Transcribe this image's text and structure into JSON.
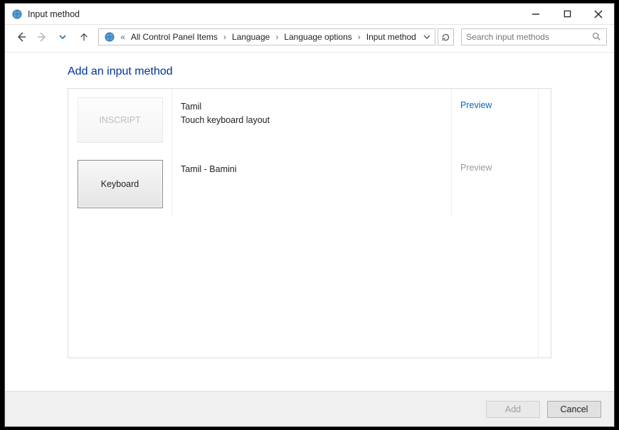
{
  "window": {
    "title": "Input method"
  },
  "breadcrumbs": {
    "items": [
      "All Control Panel Items",
      "Language",
      "Language options",
      "Input method"
    ],
    "prefix_glyph": "«"
  },
  "search": {
    "placeholder": "Search input methods"
  },
  "page": {
    "heading": "Add an input method"
  },
  "methods": [
    {
      "tile_label": "INSCRIPT",
      "name": "Tamil",
      "sub": "Touch keyboard layout",
      "preview_label": "Preview",
      "preview_enabled": true,
      "selected": false
    },
    {
      "tile_label": "Keyboard",
      "name": "Tamil - Bamini",
      "sub": "",
      "preview_label": "Preview",
      "preview_enabled": false,
      "selected": true
    }
  ],
  "footer": {
    "add_label": "Add",
    "cancel_label": "Cancel",
    "add_enabled": false
  }
}
